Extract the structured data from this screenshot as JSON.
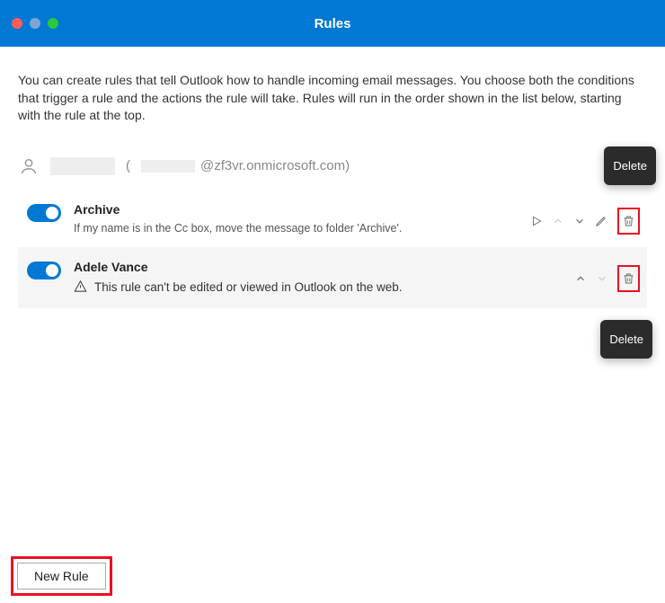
{
  "window": {
    "title": "Rules"
  },
  "intro": "You can create rules that tell Outlook how to handle incoming email messages. You choose both the conditions that trigger a rule and the actions the rule will take. Rules will run in the order shown in the list below, starting with the rule at the top.",
  "account": {
    "domain": "@zf3vr.onmicrosoft.com)",
    "open_paren": "("
  },
  "rules": [
    {
      "name": "Archive",
      "description": "If my name is in the Cc box, move the message to folder 'Archive'.",
      "enabled": true,
      "editable": true
    },
    {
      "name": "Adele Vance",
      "warning": "This rule can't be edited or viewed in Outlook on the web.",
      "enabled": true,
      "editable": false
    }
  ],
  "tooltips": {
    "delete1": "Delete",
    "delete2": "Delete"
  },
  "buttons": {
    "new_rule": "New Rule"
  }
}
